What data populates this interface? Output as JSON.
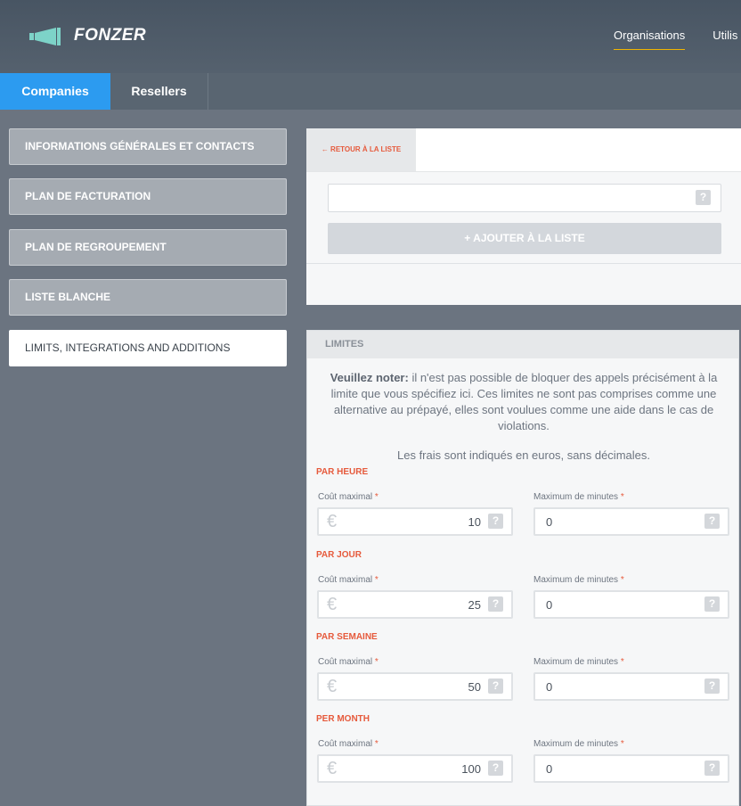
{
  "app": {
    "name": "FONZER"
  },
  "top_nav": [
    {
      "label": "Organisations",
      "active": true
    },
    {
      "label": "Utilis"
    }
  ],
  "tabs": [
    {
      "label": "Companies",
      "active": true
    },
    {
      "label": "Resellers"
    }
  ],
  "sidebar": {
    "items": [
      {
        "label": "INFORMATIONS GÉNÉRALES ET CONTACTS"
      },
      {
        "label": "PLAN DE FACTURATION"
      },
      {
        "label": "PLAN DE REGROUPEMENT"
      },
      {
        "label": "LISTE BLANCHE"
      },
      {
        "label": "LIMITS, INTEGRATIONS AND ADDITIONS",
        "active": true
      }
    ]
  },
  "back_link": "← RETOUR À LA LISTE",
  "list_panel": {
    "add_button": "+ AJOUTER À LA LISTE",
    "help": "?"
  },
  "limits": {
    "title": "LIMITES",
    "note_bold": "Veuillez noter:",
    "note_text": " il n'est pas possible de bloquer des appels précisément à la limite que vous spécifiez ici. Ces limites ne sont pas comprises comme une alternative au prépayé, elles sont voulues comme une aide dans le cas de violations.",
    "note2": "Les frais sont indiqués en euros, sans décimales.",
    "currency_symbol": "€",
    "required_mark": "*",
    "help": "?",
    "sections": [
      {
        "title": "PAR HEURE",
        "cost_label": "Coût maximal",
        "minutes_label": "Maximum de minutes",
        "cost_value": "10",
        "minutes_value": "0"
      },
      {
        "title": "PAR JOUR",
        "cost_label": "Coût maximal",
        "minutes_label": "Maximum de minutes",
        "cost_value": "25",
        "minutes_value": "0"
      },
      {
        "title": "PAR SEMAINE",
        "cost_label": "Coût maximal",
        "minutes_label": "Maximum de minutes",
        "cost_value": "50",
        "minutes_value": "0"
      },
      {
        "title": "PER MONTH",
        "cost_label": "Coût maximal",
        "minutes_label": "Maximum de minutes",
        "cost_value": "100",
        "minutes_value": "0"
      }
    ]
  },
  "colors": {
    "accent_blue": "#2c9bf0",
    "accent_orange": "#e65a3c",
    "nav_underline": "#f0b400",
    "logo_teal": "#7dd3c8"
  }
}
